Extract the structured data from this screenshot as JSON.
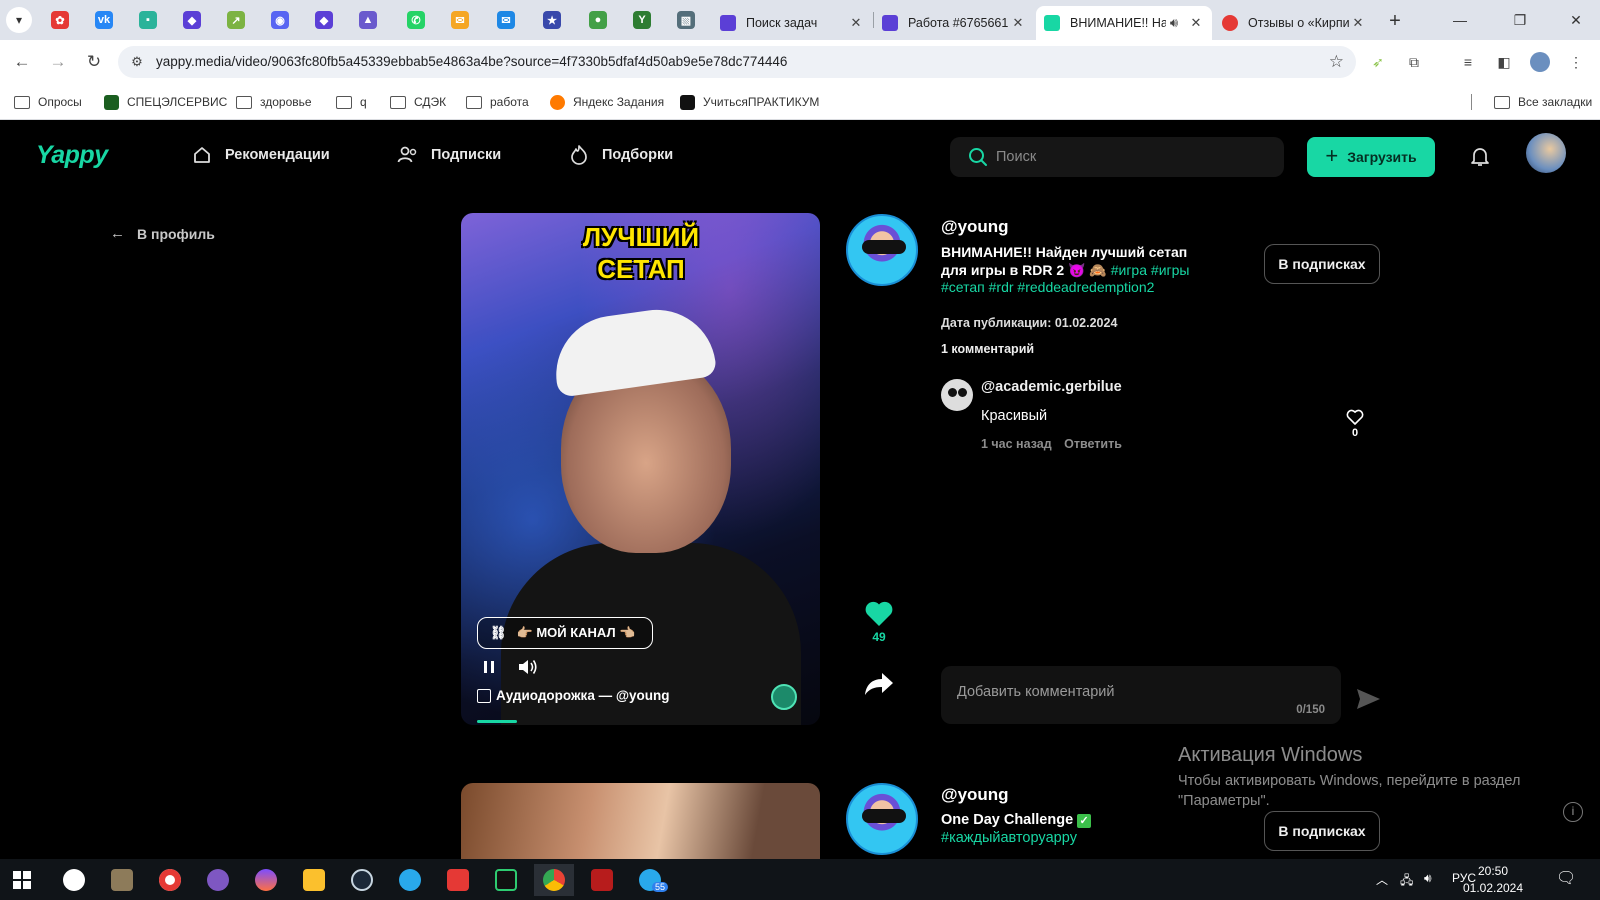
{
  "browser": {
    "tabs": [
      {
        "title": "Поиск задач",
        "color": "#5b3fd6"
      },
      {
        "title": "Работа #6765661",
        "color": "#5b3fd6"
      },
      {
        "title": "ВНИМАНИЕ!! Найден лучший сетап",
        "color": "#18d7a4",
        "active": true
      },
      {
        "title": "Отзывы о «Кирпич»",
        "color": "#e53935"
      }
    ],
    "url": "yappy.media/video/9063fc80fb5a45339ebbab5e4863a4be?source=4f7330b5dfaf4d50ab9e5e78dc774446",
    "bookmarks": [
      {
        "label": "Опросы",
        "icon": "folder-icon"
      },
      {
        "label": "СПЕЦЭЛСЕРВИС",
        "icon": "green-square-icon"
      },
      {
        "label": "здоровье",
        "icon": "folder-icon"
      },
      {
        "label": "q",
        "icon": "folder-icon"
      },
      {
        "label": "СДЭК",
        "icon": "folder-icon"
      },
      {
        "label": "работа",
        "icon": "folder-icon"
      },
      {
        "label": "Яндекс Задания",
        "icon": "yandex-tasks-icon"
      },
      {
        "label": "УчитьсяПРАКТИКУМ",
        "icon": "praktikum-icon"
      }
    ],
    "all_bookmarks": "Все закладки"
  },
  "site": {
    "logo": "Yappy",
    "nav": {
      "recommendations": "Рекомендации",
      "subscriptions": "Подписки",
      "collections": "Подборки"
    },
    "search_placeholder": "Поиск",
    "upload": "Загрузить",
    "back_to_profile": "В профиль",
    "accent_color": "#18d7a4"
  },
  "post": {
    "video_title_line1": "ЛУЧШИЙ",
    "video_title_line2": "СЕТАП",
    "channel_button": "👉🏼 МОЙ КАНАЛ 👈🏼",
    "audio_track": "Аудиодорожка — @young",
    "author": "@young",
    "description": "ВНИМАНИЕ!! Найден лучший сетап для игры в RDR 2 😈 🙈",
    "tags": [
      "#игра",
      "#игры",
      "#сетап",
      "#rdr",
      "#reddeadredemption2"
    ],
    "publication_date": "Дата публикации: 01.02.2024",
    "comments_count": "1 комментарий",
    "subscribe_state": "В подписках",
    "likes": "49",
    "comment_input_placeholder": "Добавить комментарий",
    "comment_counter": "0/150",
    "comments": [
      {
        "author": "@academic.gerbilue",
        "text": "Красивый",
        "time": "1 час назад",
        "reply": "Ответить",
        "likes": "0"
      }
    ]
  },
  "post2": {
    "author": "@young",
    "description": "One Day Challenge",
    "tag": "#каждыйавторуappy",
    "subscribe_state": "В подписках"
  },
  "windows": {
    "activation_title": "Активация Windows",
    "activation_text": "Чтобы активировать Windows, перейдите в раздел \"Параметры\".",
    "language": "РУС",
    "time": "20:50",
    "date": "01.02.2024",
    "telegram_badge": "55"
  }
}
